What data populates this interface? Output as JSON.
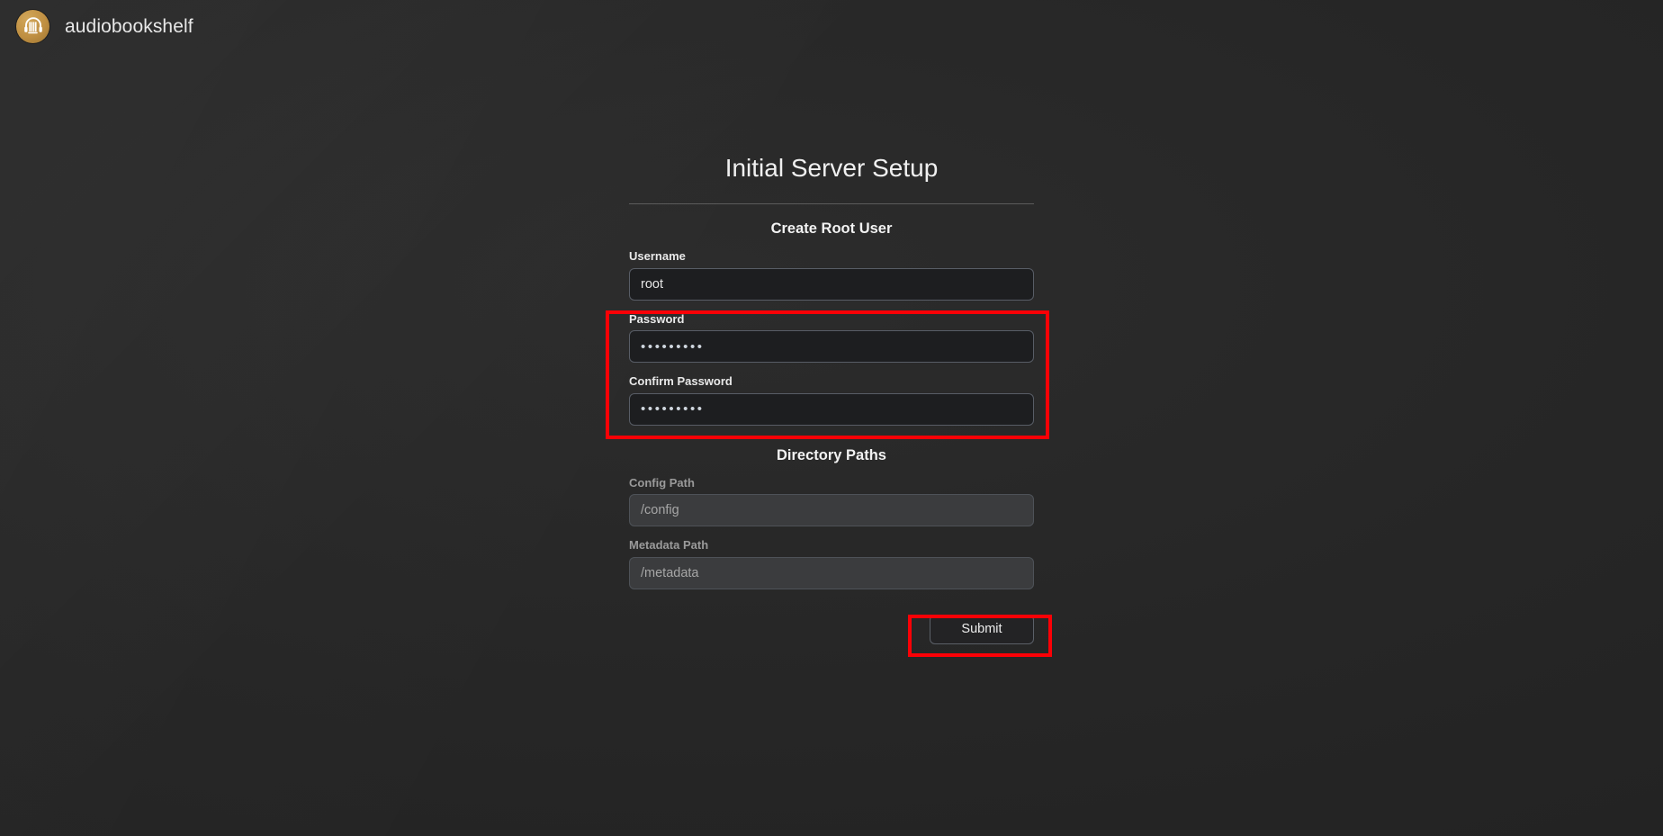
{
  "header": {
    "app_name": "audiobookshelf",
    "logo_icon": "audiobookshelf-headphones-book-logo"
  },
  "setup": {
    "title": "Initial Server Setup",
    "root_user": {
      "heading": "Create Root User",
      "fields": {
        "username": {
          "label": "Username",
          "value": "root",
          "placeholder": "",
          "disabled": false
        },
        "password": {
          "label": "Password",
          "value": "•••••••••",
          "placeholder": "",
          "disabled": false
        },
        "confirm_password": {
          "label": "Confirm Password",
          "value": "•••••••••",
          "placeholder": "",
          "disabled": false
        }
      }
    },
    "directory_paths": {
      "heading": "Directory Paths",
      "fields": {
        "config_path": {
          "label": "Config Path",
          "value": "/config",
          "placeholder": "/config",
          "disabled": true
        },
        "metadata_path": {
          "label": "Metadata Path",
          "value": "/metadata",
          "placeholder": "/metadata",
          "disabled": true
        }
      }
    },
    "submit_label": "Submit"
  },
  "annotations": {
    "password_highlight_color": "#fb0006",
    "submit_highlight_color": "#fb0006"
  },
  "colors": {
    "background": "#252525",
    "accent_gold": "#bf8f42",
    "input_background": "#1d1e20",
    "input_border": "#585d66",
    "disabled_input_background": "#3b3c3e",
    "text_primary": "#e8e8e8",
    "text_muted": "#9a9a9a"
  }
}
